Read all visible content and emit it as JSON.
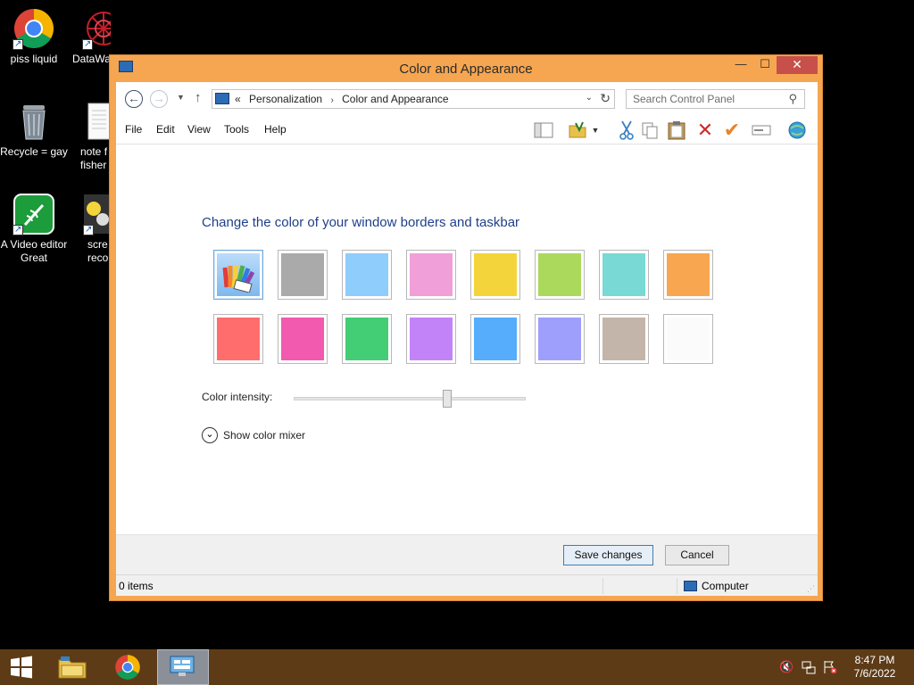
{
  "desktop": {
    "icons": [
      {
        "label": "piss liquid"
      },
      {
        "label": "DataWa"
      },
      {
        "label": "Recycle = gay"
      },
      {
        "label": "note f fisher"
      },
      {
        "label": "A Video editor Great"
      },
      {
        "label": "scre recor"
      }
    ]
  },
  "window": {
    "title": "Color and Appearance",
    "address": {
      "prefix": "«",
      "crumbs": [
        "Personalization",
        "Color and Appearance"
      ]
    },
    "search": {
      "placeholder": "Search Control Panel"
    },
    "menu": [
      "File",
      "Edit",
      "View",
      "Tools",
      "Help"
    ],
    "heading": "Change the color of your window borders and taskbar",
    "swatches": [
      {
        "name": "automatic",
        "color": "#4d8fe0",
        "selected": true
      },
      {
        "name": "gray",
        "color": "#aaaaaa"
      },
      {
        "name": "light-blue",
        "color": "#8fcdfc"
      },
      {
        "name": "pink",
        "color": "#f19fd8"
      },
      {
        "name": "yellow",
        "color": "#f3d53b"
      },
      {
        "name": "lime",
        "color": "#aad95c"
      },
      {
        "name": "teal",
        "color": "#78d9d5"
      },
      {
        "name": "orange",
        "color": "#f8a650"
      },
      {
        "name": "red",
        "color": "#ff6d6d"
      },
      {
        "name": "magenta",
        "color": "#f15aae"
      },
      {
        "name": "green",
        "color": "#43cd75"
      },
      {
        "name": "purple",
        "color": "#c383f8"
      },
      {
        "name": "blue",
        "color": "#55adfc"
      },
      {
        "name": "lavender",
        "color": "#9e9efd"
      },
      {
        "name": "taupe",
        "color": "#c3b5a9"
      },
      {
        "name": "white",
        "color": "#fbfbfb"
      }
    ],
    "intensity": {
      "label": "Color intensity:",
      "value": 0.66
    },
    "mixer": {
      "label": "Show color mixer"
    },
    "buttons": {
      "save": "Save changes",
      "cancel": "Cancel"
    },
    "status": {
      "items": "0 items",
      "location": "Computer"
    }
  },
  "taskbar": {
    "time": "8:47 PM",
    "date": "7/6/2022"
  },
  "colors": {
    "frame": "#f6a650",
    "heading": "#1e3f8a",
    "taskbar": "#5d3b17"
  }
}
